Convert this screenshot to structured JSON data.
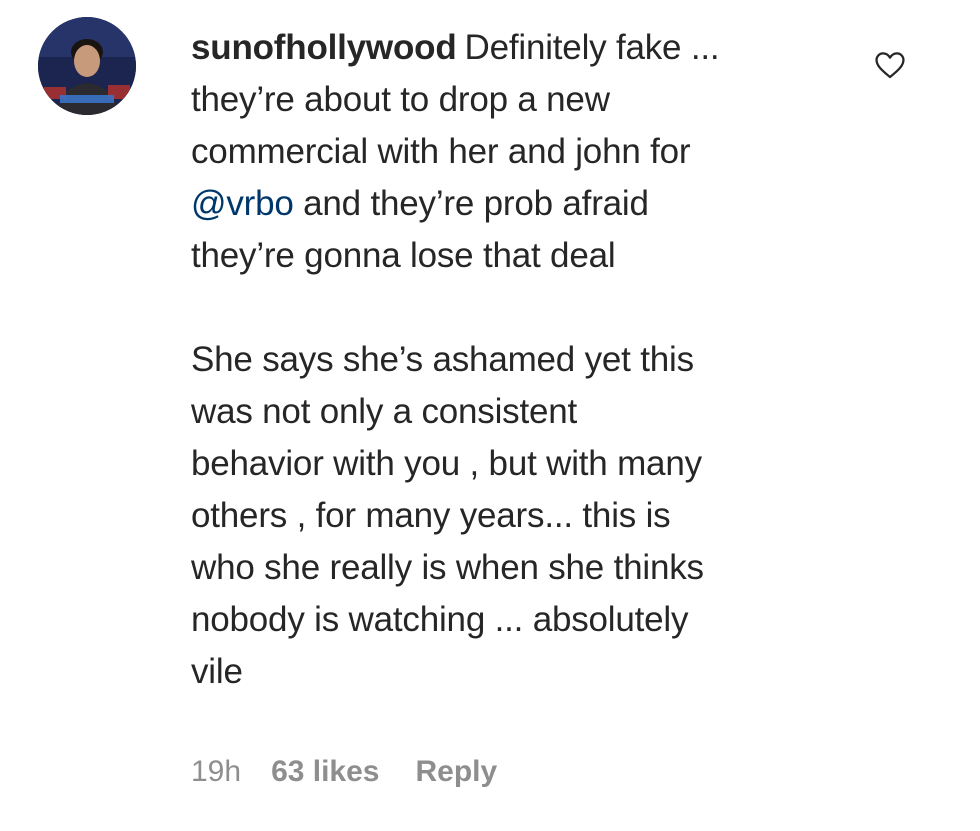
{
  "comment": {
    "username": "sunofhollywood",
    "text_first_line": "Definitely fake ...",
    "text_line2": "they’re about to drop a new",
    "text_line3": "commercial with her and john for",
    "mention": "@vrbo",
    "text_line4_rest": " and they’re prob afraid",
    "text_line5": "they’re gonna lose that deal",
    "para2": [
      "She says she’s ashamed yet this",
      "was not only a consistent",
      "behavior with you , but with many",
      "others , for many years... this is",
      "who she really is when she thinks",
      "nobody is watching ... absolutely",
      "vile"
    ],
    "time": "19h",
    "likes": "63 likes",
    "reply_label": "Reply",
    "like_icon": "heart-outline-icon"
  },
  "colors": {
    "text": "#262626",
    "muted": "#8e8e8e",
    "mention": "#00376b"
  }
}
